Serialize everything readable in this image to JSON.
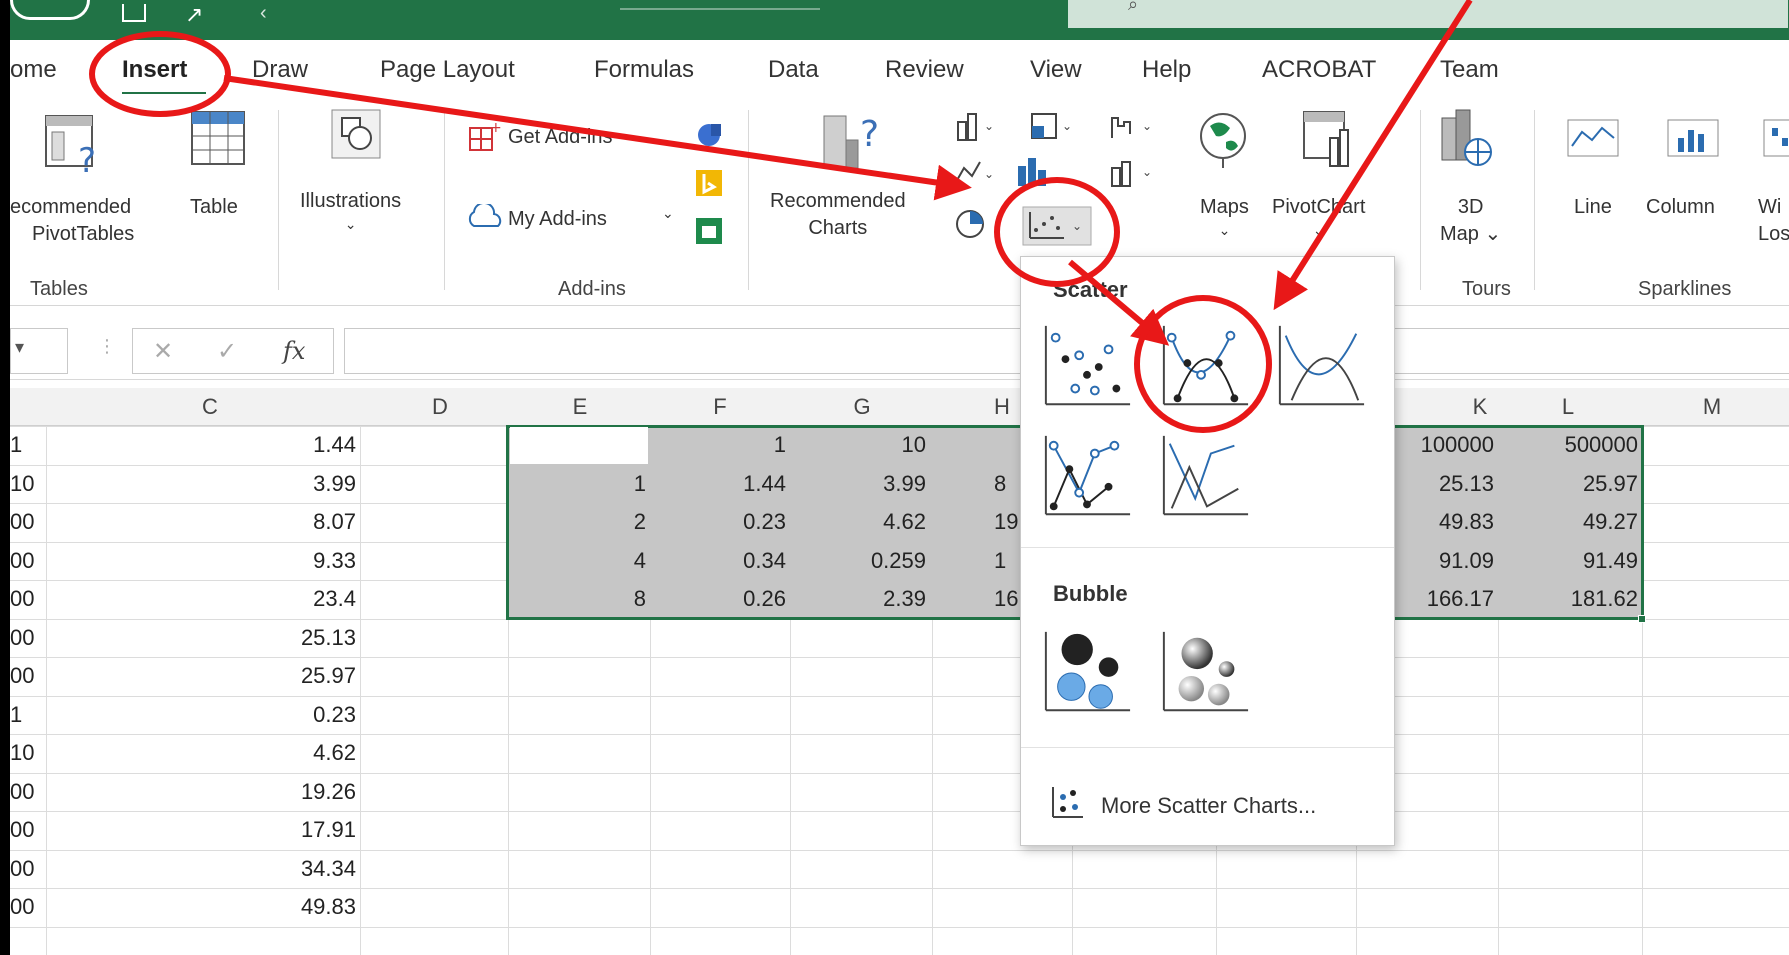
{
  "ribbon": {
    "tabs": [
      "ome",
      "Insert",
      "Draw",
      "Page Layout",
      "Formulas",
      "Data",
      "Review",
      "View",
      "Help",
      "ACROBAT",
      "Team"
    ],
    "active_tab": "Insert",
    "tables_group": {
      "recommended_pivot_l1": "ecommended",
      "recommended_pivot_l2": "PivotTables",
      "table": "Table",
      "label": "Tables"
    },
    "illustrations": "Illustrations",
    "addins": {
      "get": "Get Add-ins",
      "my": "My Add-ins",
      "label": "Add-ins"
    },
    "charts": {
      "recommended_l1": "Recommended",
      "recommended_l2": "Charts",
      "maps": "Maps",
      "pivotchart": "PivotChart"
    },
    "tours": {
      "map_l1": "3D",
      "map_l2": "Map",
      "label": "Tours"
    },
    "sparklines": {
      "line": "Line",
      "column": "Column",
      "winloss_l1": "Wi",
      "winloss_l2": "Los",
      "label": "Sparklines"
    }
  },
  "formula_bar": {
    "fx": "fx",
    "cancel": "✕",
    "enter": "✓"
  },
  "columns": [
    "C",
    "D",
    "E",
    "F",
    "G",
    "H",
    "K",
    "L",
    "M"
  ],
  "sheet": {
    "col_b_fragments": [
      "1",
      "10",
      "00",
      "00",
      "00",
      "00",
      "00",
      "1",
      "10",
      "00",
      "00",
      "00",
      "00"
    ],
    "col_c": [
      "1.44",
      "3.99",
      "8.07",
      "9.33",
      "23.4",
      "25.13",
      "25.97",
      "0.23",
      "4.62",
      "19.26",
      "17.91",
      "34.34",
      "49.83"
    ],
    "table_header": [
      "1",
      "10"
    ],
    "table_rows": [
      {
        "e": "1",
        "f": "1.44",
        "g": "3.99",
        "h": "8"
      },
      {
        "e": "2",
        "f": "0.23",
        "g": "4.62",
        "h": "19"
      },
      {
        "e": "4",
        "f": "0.34",
        "g": "0.259",
        "h": "1"
      },
      {
        "e": "8",
        "f": "0.26",
        "g": "2.39",
        "h": "16"
      }
    ],
    "k_col": [
      "100000",
      "25.13",
      "49.83",
      "91.09",
      "166.17"
    ],
    "l_col": [
      "500000",
      "25.97",
      "49.27",
      "91.49",
      "181.62"
    ]
  },
  "dropdown": {
    "scatter_heading": "Scatter",
    "bubble_heading": "Bubble",
    "more": "More Scatter Charts..."
  },
  "colors": {
    "excel_green": "#217346",
    "selection_gray": "#c6c6c6",
    "annotation_red": "#e81818"
  }
}
